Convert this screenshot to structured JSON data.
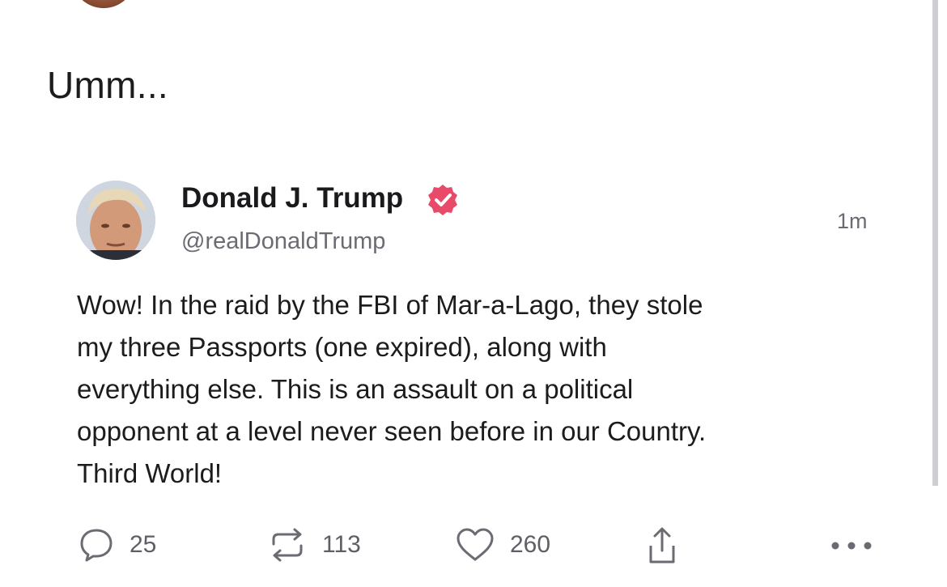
{
  "comment": {
    "text": "Umm..."
  },
  "post": {
    "author": {
      "name": "Donald J. Trump",
      "handle": "@realDonaldTrump",
      "verified": true,
      "badge_color": "#e84a6a"
    },
    "timestamp": "1m",
    "body_lines": [
      "Wow! In the raid by the FBI of Mar-a-Lago, they stole",
      "my three Passports (one expired), along with",
      "everything else. This is an assault on a political",
      "opponent at a level never seen before in our Country.",
      "Third World!"
    ],
    "actions": {
      "replies": {
        "icon": "reply-icon",
        "count": "25"
      },
      "reposts": {
        "icon": "repost-icon",
        "count": "113"
      },
      "likes": {
        "icon": "heart-icon",
        "count": "260"
      },
      "share": {
        "icon": "share-icon"
      },
      "more": {
        "icon": "more-icon"
      }
    }
  }
}
